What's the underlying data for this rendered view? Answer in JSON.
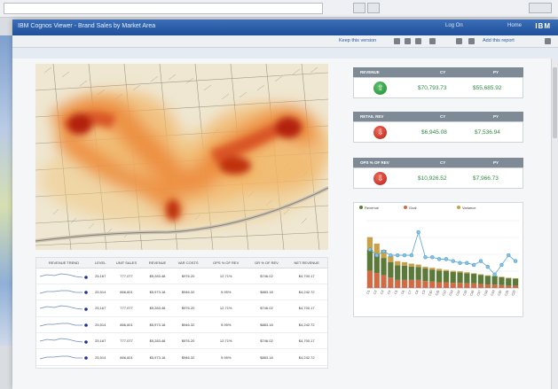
{
  "browser": {
    "address_placeholder": ""
  },
  "window": {
    "title": "IBM Cognos Viewer - Brand Sales by Market Area",
    "title_right": [
      "Log On",
      "Home"
    ],
    "brand": "IBM"
  },
  "toolbar": {
    "links": [
      "Keep this version",
      "Add this report"
    ]
  },
  "subbar": {
    "text": ""
  },
  "kpis": [
    {
      "title": "REVENUE",
      "col1": "CY",
      "col2": "PY",
      "trend": "up",
      "cy": "$70,793.73",
      "py": "$55,685.92"
    },
    {
      "title": "RETAIL REV",
      "col1": "CY",
      "col2": "PY",
      "trend": "down",
      "cy": "$6,945.08",
      "py": "$7,536.94"
    },
    {
      "title": "OPS % OF REV",
      "col1": "CY",
      "col2": "PY",
      "trend": "down",
      "cy": "$10,926.52",
      "py": "$7,966.73"
    }
  ],
  "table": {
    "headers": [
      "REVENUE TREND",
      "LEVEL",
      "UNIT SALES",
      "REVENUE",
      "VAR COSTS",
      "OPS % OF REV",
      "GR % OF REV",
      "NET REVENUE"
    ],
    "rows": [
      [
        "",
        "25,167",
        "777,077",
        "$5,283.48",
        "$976.20",
        "12.71%",
        "$746.02",
        "$4,700.17"
      ],
      [
        "",
        "25,514",
        "866,601",
        "$5,973.18",
        "$946.32",
        "9.95%",
        "$883.18",
        "$4,242.72"
      ],
      [
        "",
        "25,167",
        "777,077",
        "$5,283.48",
        "$976.20",
        "12.71%",
        "$746.02",
        "$4,700.17"
      ],
      [
        "",
        "25,514",
        "866,601",
        "$5,973.18",
        "$946.32",
        "9.95%",
        "$883.18",
        "$4,242.72"
      ],
      [
        "",
        "25,167",
        "777,077",
        "$5,283.48",
        "$976.20",
        "12.71%",
        "$746.02",
        "$4,700.17"
      ],
      [
        "",
        "25,514",
        "866,601",
        "$5,973.18",
        "$946.32",
        "9.95%",
        "$883.18",
        "$4,242.72"
      ]
    ]
  },
  "colors": {
    "accent": "#1f4f9a",
    "up": "#2f8a3f",
    "down": "#c0261b"
  },
  "chart_data": {
    "type": "bar",
    "title": "",
    "categories": [
      "C1",
      "C2",
      "C3",
      "C4",
      "C5",
      "C6",
      "C7",
      "C8",
      "C9",
      "C10",
      "C11",
      "C12",
      "C13",
      "C14",
      "C15",
      "C16",
      "C17",
      "C18",
      "C19",
      "C20",
      "C21",
      "C22"
    ],
    "series": [
      {
        "name": "Revenue",
        "values": [
          48,
          44,
          40,
          36,
          34,
          33,
          31,
          30,
          29,
          28,
          27,
          26,
          25,
          24,
          23,
          22,
          21,
          20,
          19,
          18,
          17,
          16
        ]
      },
      {
        "name": "Goal",
        "values": [
          30,
          26,
          22,
          18,
          14,
          14,
          14,
          14,
          12,
          11,
          10,
          10,
          9,
          9,
          8,
          8,
          7,
          6,
          6,
          5,
          4,
          4
        ]
      },
      {
        "name": "Variance",
        "values": [
          22,
          18,
          14,
          10,
          7,
          6,
          5,
          4,
          3,
          3,
          3,
          2,
          2,
          2,
          2,
          1,
          1,
          1,
          1,
          1,
          1,
          1
        ]
      }
    ],
    "line": [
      40,
      34,
      38,
      34,
      34,
      34,
      34,
      58,
      32,
      32,
      30,
      30,
      28,
      26,
      26,
      24,
      28,
      22,
      14,
      24,
      34,
      28
    ],
    "ylim": [
      0,
      70
    ]
  }
}
